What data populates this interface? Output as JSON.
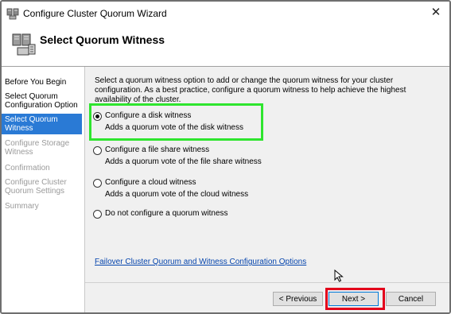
{
  "window": {
    "title": "Configure Cluster Quorum Wizard",
    "close_glyph": "✕"
  },
  "header": {
    "title": "Select Quorum Witness"
  },
  "sidebar": {
    "items": [
      {
        "label": "Before You Begin",
        "state": "normal"
      },
      {
        "label": "Select Quorum Configuration Option",
        "state": "normal"
      },
      {
        "label": "Select Quorum Witness",
        "state": "active"
      },
      {
        "label": "Configure Storage Witness",
        "state": "disabled"
      },
      {
        "label": "Confirmation",
        "state": "disabled"
      },
      {
        "label": "Configure Cluster Quorum Settings",
        "state": "disabled"
      },
      {
        "label": "Summary",
        "state": "disabled"
      }
    ]
  },
  "content": {
    "intro": "Select a quorum witness option to add or change the quorum witness for your cluster configuration. As a best practice, configure a quorum witness to help achieve the highest availability of the cluster.",
    "options": [
      {
        "label": "Configure a disk witness",
        "description": "Adds a quorum vote of the disk witness",
        "selected": true
      },
      {
        "label": "Configure a file share witness",
        "description": "Adds a quorum vote of the file share witness",
        "selected": false
      },
      {
        "label": "Configure a cloud witness",
        "description": "Adds a quorum vote of the cloud witness",
        "selected": false
      },
      {
        "label": "Do not configure a quorum witness",
        "description": "",
        "selected": false
      }
    ],
    "link_text": "Failover Cluster Quorum and Witness Configuration Options"
  },
  "footer": {
    "previous_label": "< Previous",
    "next_label": "Next >",
    "cancel_label": "Cancel"
  },
  "colors": {
    "active_nav": "#2a7ad5",
    "green_highlight": "#2ee52e",
    "red_highlight": "#e3001b",
    "link": "#0645ad"
  }
}
